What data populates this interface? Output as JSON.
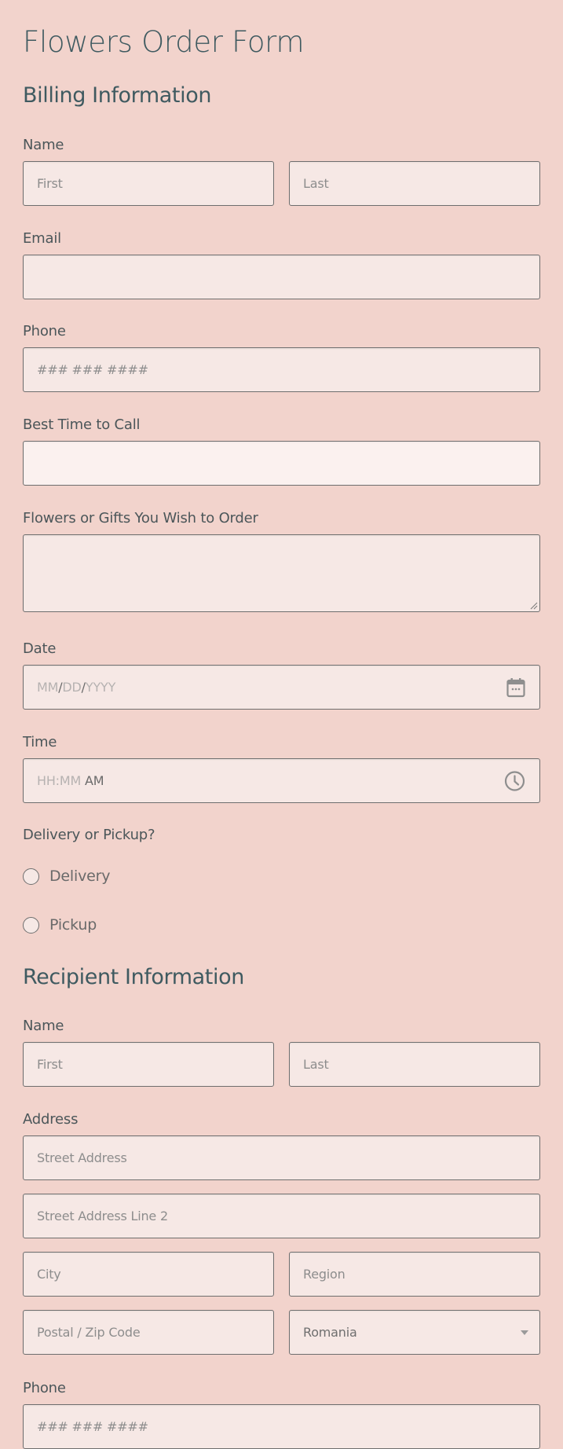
{
  "form": {
    "title": "Flowers Order Form"
  },
  "billing": {
    "heading": "Billing Information",
    "name": {
      "label": "Name",
      "first_placeholder": "First",
      "last_placeholder": "Last",
      "first_value": "",
      "last_value": ""
    },
    "email": {
      "label": "Email",
      "value": ""
    },
    "phone": {
      "label": "Phone",
      "placeholder": "### ### ####",
      "value": ""
    },
    "best_time": {
      "label": "Best Time to Call",
      "value": ""
    },
    "order": {
      "label": "Flowers or Gifts You Wish to Order",
      "value": ""
    },
    "date": {
      "label": "Date",
      "mm": "MM",
      "dd": "DD",
      "yyyy": "YYYY",
      "sep": "/",
      "icon": "calendar-icon"
    },
    "time": {
      "label": "Time",
      "hhmm": "HH:MM",
      "ampm": "AM",
      "icon": "clock-icon"
    },
    "delivery": {
      "label": "Delivery or Pickup?",
      "options": [
        {
          "label": "Delivery",
          "checked": false
        },
        {
          "label": "Pickup",
          "checked": false
        }
      ]
    }
  },
  "recipient": {
    "heading": "Recipient Information",
    "name": {
      "label": "Name",
      "first_placeholder": "First",
      "last_placeholder": "Last"
    },
    "address": {
      "label": "Address",
      "street_placeholder": "Street Address",
      "street2_placeholder": "Street Address Line 2",
      "city_placeholder": "City",
      "region_placeholder": "Region",
      "postal_placeholder": "Postal / Zip Code",
      "country_selected": "Romania"
    },
    "phone": {
      "label": "Phone",
      "placeholder": "### ### ####"
    }
  },
  "colors": {
    "background": "#f2d3cc",
    "field": "#f6e8e5",
    "field_highlight": "#fbf1ef",
    "heading": "#3f5a60",
    "border": "#6e6e6e"
  }
}
